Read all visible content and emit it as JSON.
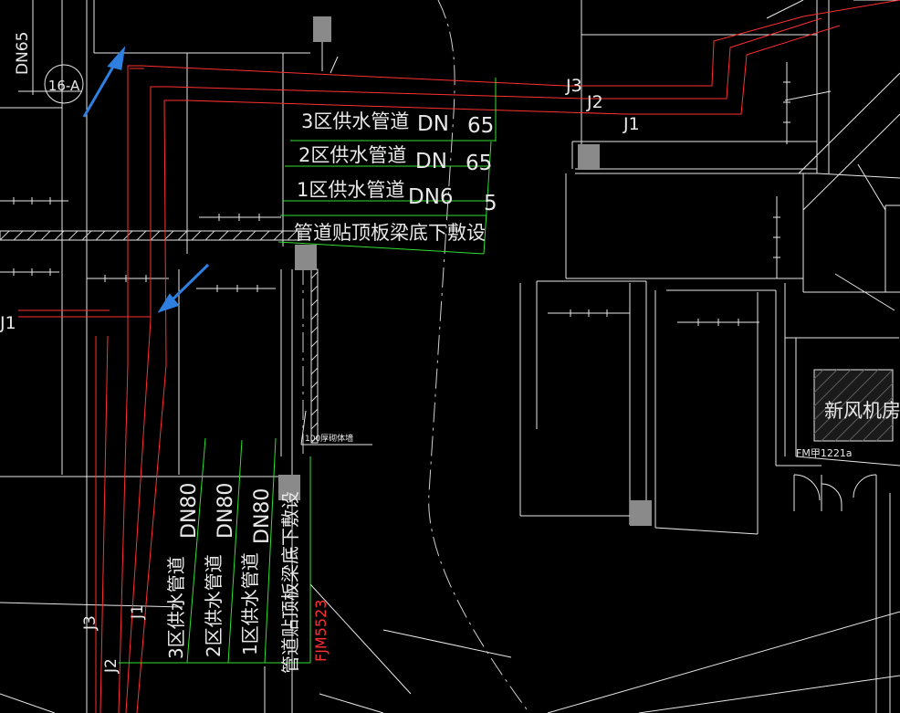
{
  "drawing": {
    "callout_horizontal": {
      "line1": "3区供水管道",
      "line1_dn": "DN",
      "line1_size": "65",
      "line2": "2区供水管道",
      "line2_dn": "DN",
      "line2_size": "65",
      "line3": "1区供水管道",
      "line3_dn": "DN6",
      "line3_size": "5",
      "line4": "管道贴顶板梁底下敷设"
    },
    "callout_vertical": {
      "col1_text": "3区供水管道",
      "col1_dn": "DN80",
      "col2_text": "2区供水管道",
      "col2_dn": "DN80",
      "col3_text": "1区供水管道",
      "col3_dn": "DN80",
      "col4_text": "管道贴顶板梁底下敷设"
    },
    "pipe_labels": {
      "j3_top": "J3",
      "j2_top": "J2",
      "j1_top": "J1",
      "j1_left": "J1",
      "j3_bottom": "J3",
      "j2_bottom": "J2",
      "j1_bottom": "J1"
    },
    "left_top_label": "DN65",
    "section_marker": "16-A",
    "wall_note": "100厚砌体墙",
    "room_name": "新风机房",
    "door_tag": "FM甲1221a",
    "door_tag_red": "FJM5523"
  },
  "colors": {
    "background": "#000000",
    "linework": "#e8e8e8",
    "pipe": "#ff3030",
    "leader": "#30e030",
    "arrow": "#2f7fe0",
    "column": "#8a8a8a"
  }
}
